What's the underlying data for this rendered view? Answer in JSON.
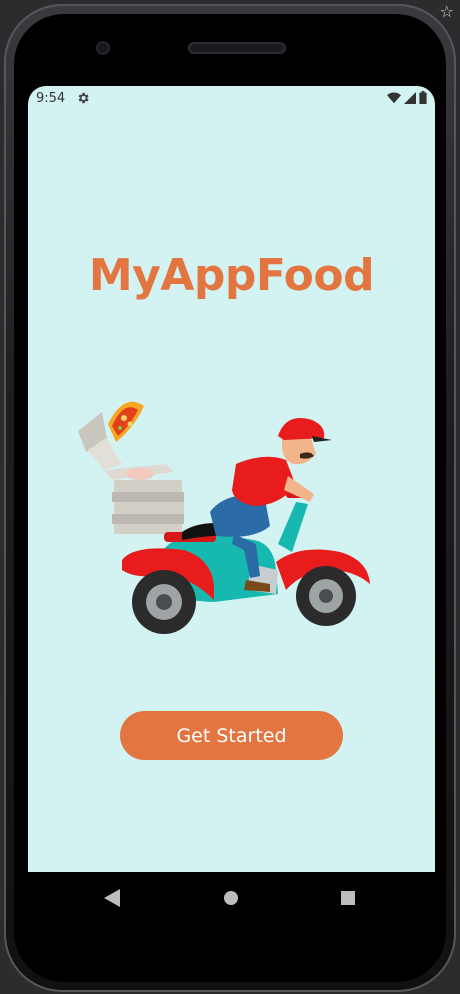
{
  "status_bar": {
    "time": "9:54",
    "icons": [
      "settings-gear-icon",
      "wifi-icon",
      "signal-icon",
      "battery-icon"
    ]
  },
  "app": {
    "title": "MyAppFood",
    "cta_label": "Get Started",
    "hero_image": "delivery-scooter-illustration"
  },
  "nav": {
    "icons": [
      "back-icon",
      "home-icon",
      "recents-icon"
    ]
  },
  "colors": {
    "background": "#d3f2f2",
    "accent": "#e37640",
    "nav_bar": "#000000"
  }
}
